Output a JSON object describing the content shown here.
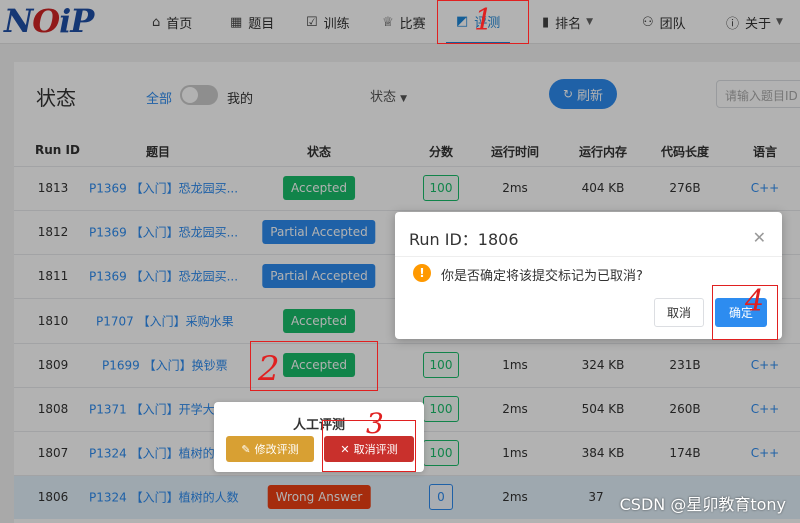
{
  "nav": {
    "logo": "NOIP",
    "items": [
      {
        "label": "首页",
        "icon": "home-icon"
      },
      {
        "label": "题目",
        "icon": "grid-icon"
      },
      {
        "label": "训练",
        "icon": "checklist-icon"
      },
      {
        "label": "比赛",
        "icon": "trophy-icon"
      },
      {
        "label": "评测",
        "icon": "chart-icon"
      },
      {
        "label": "排名",
        "icon": "bar-chart-icon"
      },
      {
        "label": "团队",
        "icon": "group-icon"
      },
      {
        "label": "关于",
        "icon": "info-icon"
      }
    ],
    "active": "评测"
  },
  "toolbar": {
    "title": "状态",
    "filter_all": "全部",
    "filter_mine": "我的",
    "status_dropdown": "状态",
    "refresh_label": "刷新",
    "search_placeholder": "请输入题目ID"
  },
  "table": {
    "headers": [
      "Run ID",
      "题目",
      "状态",
      "分数",
      "运行时间",
      "运行内存",
      "代码长度",
      "语言"
    ],
    "rows": [
      {
        "id": "1813",
        "problem": "P1369 【入门】恐龙园买...",
        "status": "Accepted",
        "score": "100",
        "time": "2ms",
        "mem": "404 KB",
        "len": "276B",
        "lang": "C++"
      },
      {
        "id": "1812",
        "problem": "P1369 【入门】恐龙园买...",
        "status": "Partial Accepted",
        "score": "",
        "time": "",
        "mem": "",
        "len": "",
        "lang": ""
      },
      {
        "id": "1811",
        "problem": "P1369 【入门】恐龙园买...",
        "status": "Partial Accepted",
        "score": "",
        "time": "",
        "mem": "",
        "len": "",
        "lang": ""
      },
      {
        "id": "1810",
        "problem": "P1707 【入门】采购水果",
        "status": "Accepted",
        "score": "",
        "time": "",
        "mem": "",
        "len": "",
        "lang": ""
      },
      {
        "id": "1809",
        "problem": "P1699 【入门】换钞票",
        "status": "Accepted",
        "score": "100",
        "time": "1ms",
        "mem": "324 KB",
        "len": "231B",
        "lang": "C++"
      },
      {
        "id": "1808",
        "problem": "P1371 【入门】开学大采...",
        "status": "",
        "score": "100",
        "time": "2ms",
        "mem": "504 KB",
        "len": "260B",
        "lang": "C++"
      },
      {
        "id": "1807",
        "problem": "P1324 【入门】植树的人...",
        "status": "",
        "score": "100",
        "time": "1ms",
        "mem": "384 KB",
        "len": "174B",
        "lang": "C++"
      },
      {
        "id": "1806",
        "problem": "P1324 【入门】植树的人数",
        "status": "Wrong Answer",
        "score": "0",
        "time": "2ms",
        "mem": "37",
        "len": "",
        "lang": ""
      }
    ]
  },
  "popover": {
    "title": "人工评测",
    "edit_label": "修改评测",
    "cancel_label": "取消评测"
  },
  "modal": {
    "title": "Run ID：1806",
    "message": "你是否确定将该提交标记为已取消?",
    "cancel_label": "取消",
    "ok_label": "确定"
  },
  "annotations": [
    "1",
    "2",
    "3",
    "4"
  ],
  "watermark": "CSDN @星卯教育tony",
  "colors": {
    "accent": "#2d8cf0",
    "accepted": "#19be6b",
    "wrong": "#ed3f14",
    "annotation": "#e02020"
  }
}
